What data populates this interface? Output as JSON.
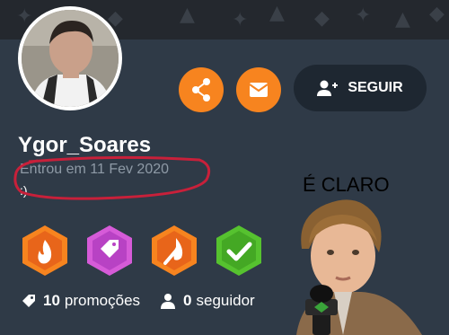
{
  "profile": {
    "username": "Ygor_Soares",
    "joined": "Entrou em 11 Fev 2020",
    "bio": ":)"
  },
  "actions": {
    "share_icon": "share-icon",
    "message_icon": "mail-icon",
    "follow_label": "SEGUIR",
    "follow_icon": "person-add-icon"
  },
  "badges": [
    {
      "name": "fire-badge",
      "color": "#f7841f"
    },
    {
      "name": "tag-badge",
      "color": "#d65bd8"
    },
    {
      "name": "flame-pen-badge",
      "color": "#f7841f"
    },
    {
      "name": "check-badge",
      "color": "#56c22f"
    }
  ],
  "stats": {
    "promotions_count": "10",
    "promotions_label": "promoções",
    "followers_count": "0",
    "followers_label": "seguidor"
  },
  "meme": {
    "caption": "É CLARO"
  },
  "colors": {
    "background": "#2f3a47",
    "accent": "#f7841f",
    "annotation": "#c8203a"
  }
}
